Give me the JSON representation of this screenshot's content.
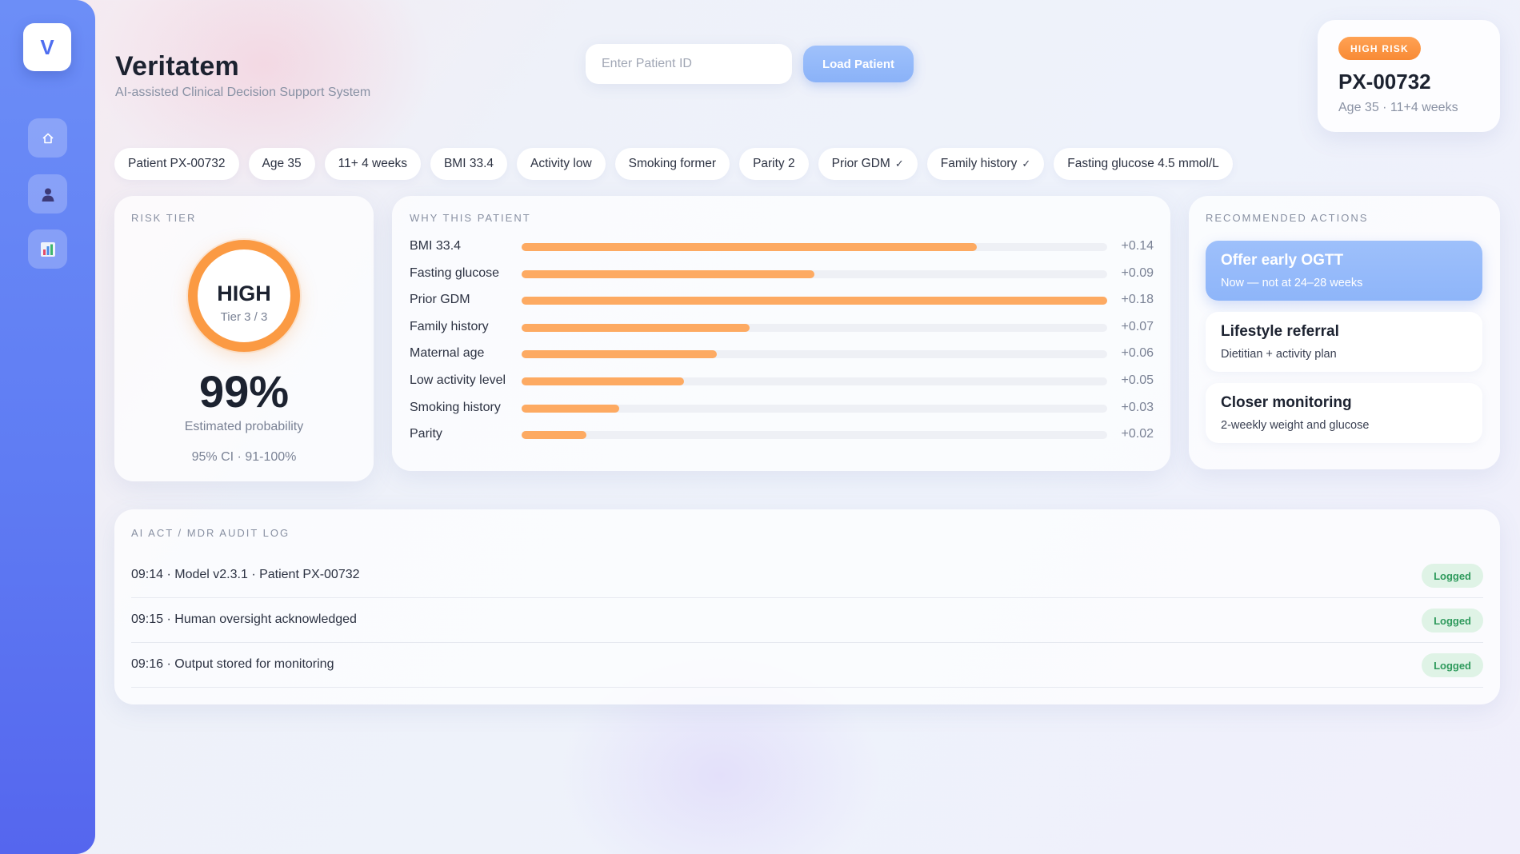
{
  "app": {
    "logo_letter": "V",
    "title": "Veritatem",
    "subtitle": "AI-assisted Clinical Decision Support System"
  },
  "sidebar": {
    "items": [
      {
        "name": "home",
        "icon": "home-icon"
      },
      {
        "name": "patient",
        "icon": "user-icon"
      },
      {
        "name": "analytics",
        "icon": "bar-chart-icon"
      }
    ]
  },
  "search": {
    "placeholder": "Enter Patient ID",
    "value": "",
    "button_label": "Load Patient"
  },
  "patient_card": {
    "badge": "HIGH RISK",
    "id": "PX-00732",
    "meta": "Age 35 · 11+4 weeks"
  },
  "chips": [
    {
      "label": "Patient PX-00732",
      "checked": false
    },
    {
      "label": "Age 35",
      "checked": false
    },
    {
      "label": "11+ 4 weeks",
      "checked": false
    },
    {
      "label": "BMI 33.4",
      "checked": false
    },
    {
      "label": "Activity low",
      "checked": false
    },
    {
      "label": "Smoking former",
      "checked": false
    },
    {
      "label": "Parity 2",
      "checked": false
    },
    {
      "label": "Prior GDM",
      "checked": true
    },
    {
      "label": "Family history",
      "checked": true
    },
    {
      "label": "Fasting glucose 4.5 mmol/L",
      "checked": false
    }
  ],
  "risk": {
    "label": "RISK TIER",
    "tier_name": "HIGH",
    "tier_text": "Tier 3 / 3",
    "probability": "99%",
    "probability_label": "Estimated probability",
    "ci": "95% CI · 91-100%",
    "accent_color": "#fb9a43"
  },
  "why": {
    "label": "WHY THIS PATIENT",
    "bar_color": "#fdaa62",
    "factors": [
      {
        "label": "BMI 33.4",
        "value": "+0.14",
        "contribution": 0.14
      },
      {
        "label": "Fasting glucose",
        "value": "+0.09",
        "contribution": 0.09
      },
      {
        "label": "Prior GDM",
        "value": "+0.18",
        "contribution": 0.18
      },
      {
        "label": "Family history",
        "value": "+0.07",
        "contribution": 0.07
      },
      {
        "label": "Maternal age",
        "value": "+0.06",
        "contribution": 0.06
      },
      {
        "label": "Low activity level",
        "value": "+0.05",
        "contribution": 0.05
      },
      {
        "label": "Smoking history",
        "value": "+0.03",
        "contribution": 0.03
      },
      {
        "label": "Parity",
        "value": "+0.02",
        "contribution": 0.02
      }
    ]
  },
  "actions": {
    "label": "RECOMMENDED ACTIONS",
    "items": [
      {
        "title": "Offer early OGTT",
        "subtitle": "Now — not at 24–28 weeks",
        "primary": true
      },
      {
        "title": "Lifestyle referral",
        "subtitle": "Dietitian + activity plan",
        "primary": false
      },
      {
        "title": "Closer monitoring",
        "subtitle": "2-weekly weight and glucose",
        "primary": false
      }
    ]
  },
  "audit": {
    "label": "AI ACT / MDR AUDIT LOG",
    "entries": [
      {
        "text": "09:14 · Model v2.3.1 · Patient PX-00732",
        "status": "Logged"
      },
      {
        "text": "09:15 · Human oversight acknowledged",
        "status": "Logged"
      },
      {
        "text": "09:16 · Output stored for monitoring",
        "status": "Logged"
      }
    ]
  }
}
